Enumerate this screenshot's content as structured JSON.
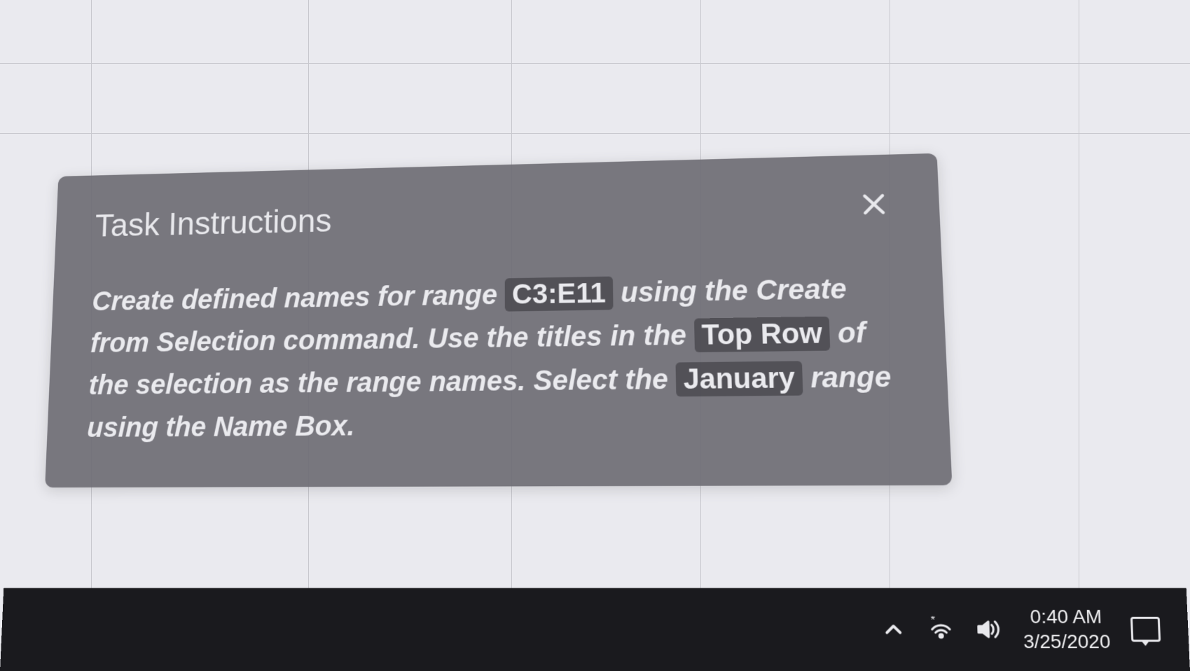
{
  "panel": {
    "title": "Task Instructions",
    "body": {
      "part1": "Create defined names for range ",
      "highlight1": "C3:E11",
      "part2": " using the Create from Selection command. Use the titles in the ",
      "highlight2": "Top Row",
      "part3": " of the selection as the range names. Select the ",
      "highlight3": "January",
      "part4": " range using the Name Box."
    }
  },
  "taskbar": {
    "time": "0:40 AM",
    "date": "3/25/2020"
  }
}
